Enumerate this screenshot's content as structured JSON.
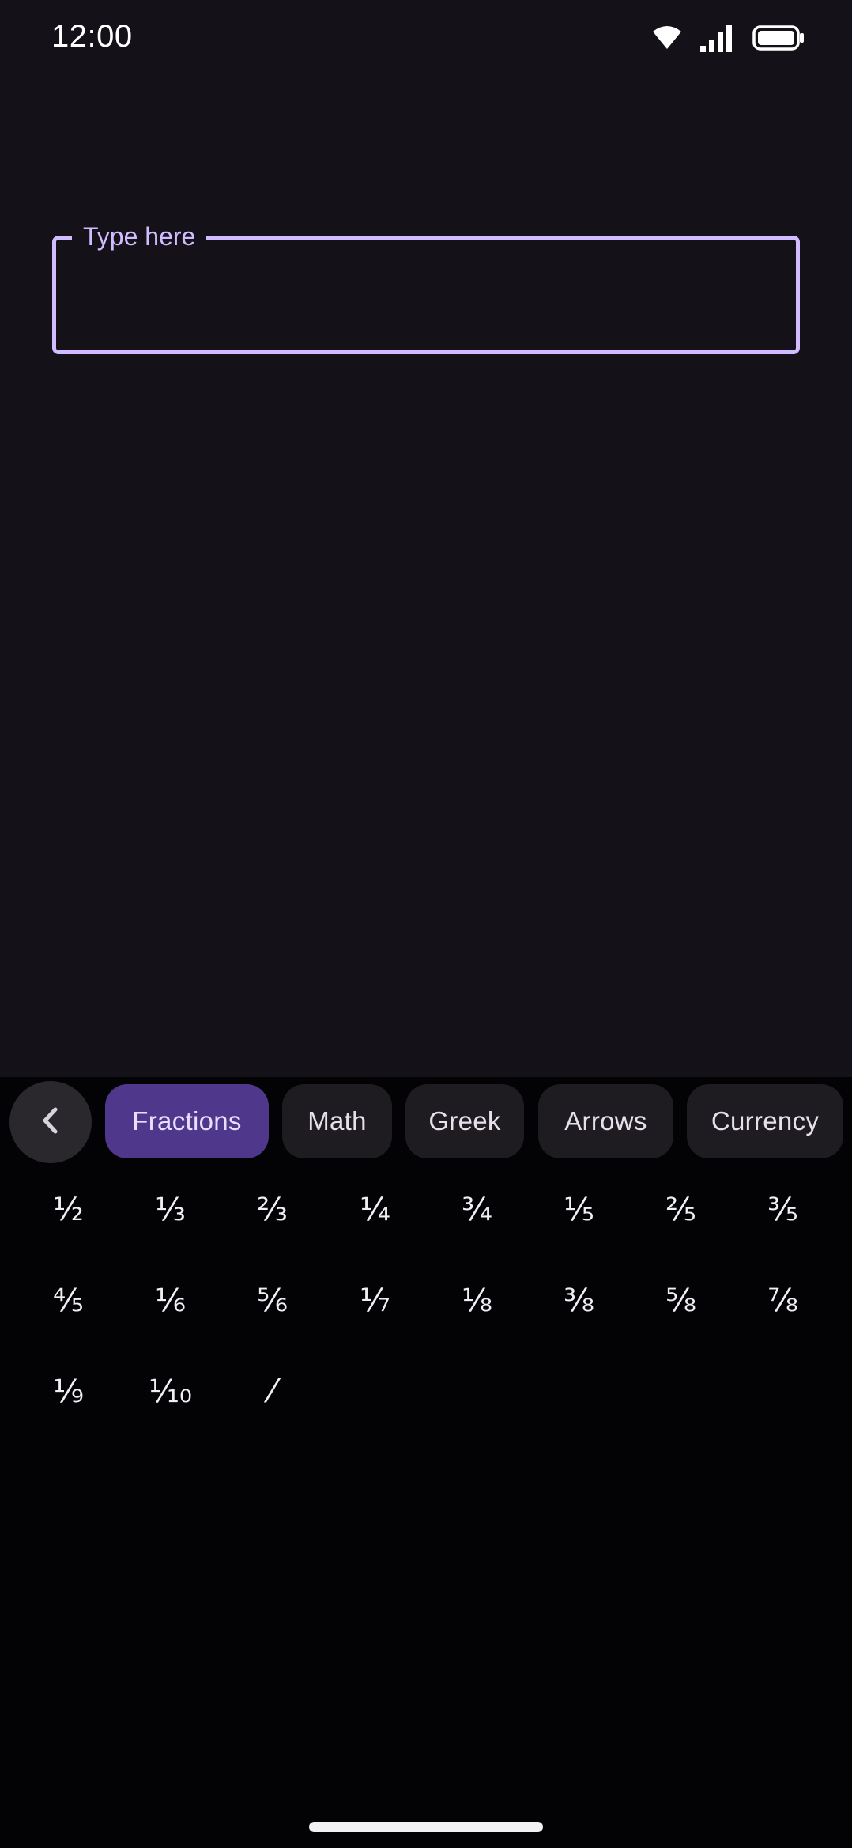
{
  "status_bar": {
    "time": "12:00",
    "icons": [
      "wifi-icon",
      "signal-icon",
      "battery-icon"
    ]
  },
  "text_field": {
    "label": "Type here",
    "value": "",
    "border_color": "#d0bcff"
  },
  "keyboard": {
    "back_icon": "chevron-left-icon",
    "categories": [
      {
        "label": "Fractions",
        "selected": true
      },
      {
        "label": "Math",
        "selected": false
      },
      {
        "label": "Greek",
        "selected": false
      },
      {
        "label": "Arrows",
        "selected": false
      },
      {
        "label": "Currency",
        "selected": false
      }
    ],
    "symbols": [
      [
        "½",
        "⅓",
        "⅔",
        "¼",
        "¾",
        "⅕",
        "⅖",
        "⅗"
      ],
      [
        "⅘",
        "⅙",
        "⅚",
        "⅐",
        "⅛",
        "⅜",
        "⅝",
        "⅞"
      ],
      [
        "⅑",
        "⅒",
        "⁄"
      ]
    ]
  },
  "colors": {
    "background": "#141218",
    "accent": "#d0bcff",
    "selected_chip": "#4f378b",
    "chip": "#1e1c21",
    "keyboard_bg": "#030204"
  }
}
